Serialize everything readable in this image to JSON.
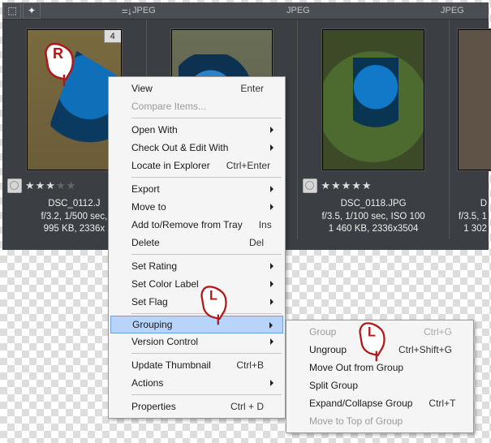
{
  "toolbar": {
    "formats": [
      "JPEG",
      "JPEG",
      "JPEG"
    ]
  },
  "thumbs": [
    {
      "badge": "4",
      "stars": "★★★",
      "stars_dim": "★★",
      "filename": "DSC_0112.J",
      "exif": "f/3.2, 1/500 sec,",
      "size": "995 KB, 2336x"
    },
    {
      "stars": "★★★★★",
      "filename": "DSC_0118.JPG",
      "exif": "f/3.5, 1/100 sec, ISO 100",
      "size": "1 460 KB, 2336x3504"
    },
    {
      "filename": "D",
      "exif": "f/3.5, 1",
      "size": "1 302"
    }
  ],
  "menu": {
    "view": "View",
    "view_s": "Enter",
    "compare": "Compare Items...",
    "open_with": "Open With",
    "checkout": "Check Out & Edit With",
    "locate": "Locate in Explorer",
    "locate_s": "Ctrl+Enter",
    "export": "Export",
    "move_to": "Move to",
    "tray": "Add to/Remove from Tray",
    "tray_s": "Ins",
    "delete": "Delete",
    "delete_s": "Del",
    "rating": "Set Rating",
    "color": "Set Color Label",
    "flag": "Set Flag",
    "grouping": "Grouping",
    "version": "Version Control",
    "thumb": "Update Thumbnail",
    "thumb_s": "Ctrl+B",
    "actions": "Actions",
    "props": "Properties",
    "props_s": "Ctrl + D"
  },
  "submenu": {
    "group": "Group",
    "group_s": "Ctrl+G",
    "ungroup": "Ungroup",
    "ungroup_s": "Ctrl+Shift+G",
    "move_out": "Move Out from Group",
    "split": "Split Group",
    "expand": "Expand/Collapse Group",
    "expand_s": "Ctrl+T",
    "totop": "Move to Top of Group"
  },
  "cursors": {
    "R": "R",
    "L": "L"
  }
}
